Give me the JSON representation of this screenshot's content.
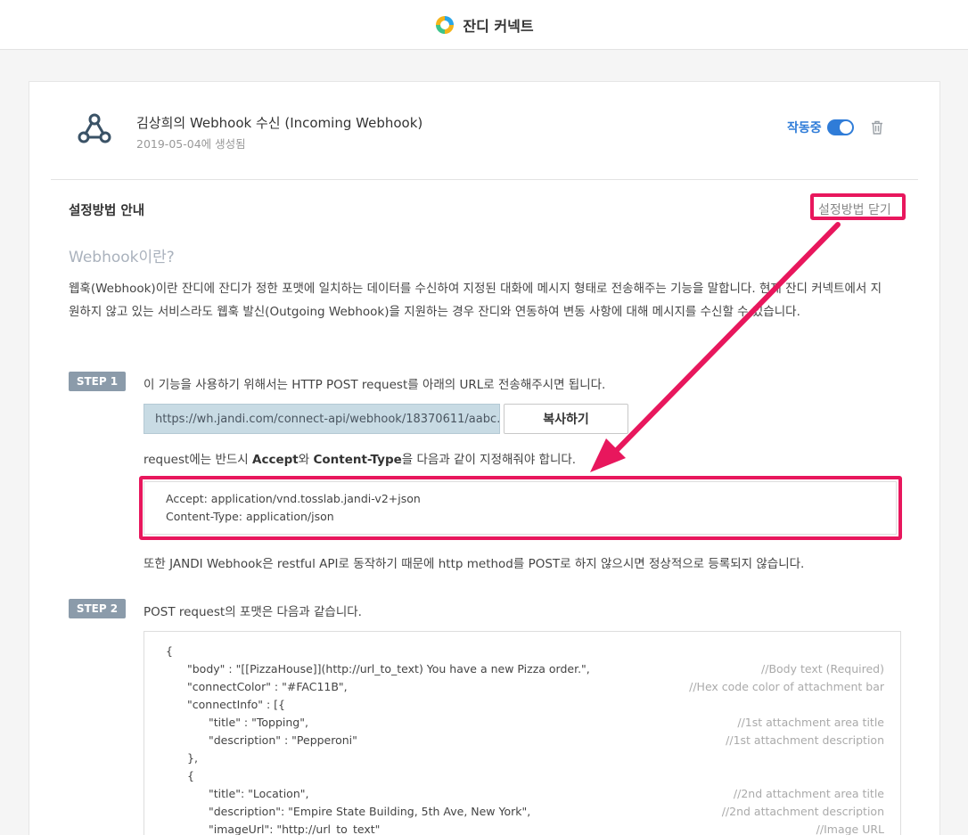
{
  "app": {
    "title": "잔디 커넥트",
    "colors": {
      "accent": "#2f7cd8",
      "highlight": "#e8175d"
    }
  },
  "connector": {
    "title": "김상희의 Webhook 수신 (Incoming Webhook)",
    "created": "2019-05-04에 생성됨",
    "status_label": "작동중",
    "toggle_on": true,
    "icon": "webhook-icon"
  },
  "guide": {
    "title": "설정방법 안내",
    "close_label": "설정방법 닫기",
    "heading": "Webhook이란?",
    "intro": "웹훅(Webhook)이란 잔디에 잔디가 정한 포맷에 일치하는 데이터를 수신하여 지정된 대화에 메시지 형태로 전송해주는 기능을 말합니다. 현재 잔디 커넥트에서 지원하지 않고 있는 서비스라도 웹훅 발신(Outgoing Webhook)을 지원하는 경우 잔디와 연동하여 변동 사항에 대해 메시지를 수신할 수 있습니다."
  },
  "step1": {
    "badge": "STEP 1",
    "text": "이 기능을 사용하기 위해서는 HTTP POST request를 아래의 URL로 전송해주시면 됩니다.",
    "url": "https://wh.jandi.com/connect-api/webhook/18370611/aabc…",
    "copy_label": "복사하기",
    "req_prefix": "request에는 반드시 ",
    "req_accept": "Accept",
    "req_and": "와 ",
    "req_ctype": "Content-Type",
    "req_suffix": "을 다음과 같이 지정해줘야 합니다.",
    "header_accept": "Accept: application/vnd.tosslab.jandi-v2+json",
    "header_ctype": "Content-Type: application/json",
    "rest_note": "또한 JANDI Webhook은 restful API로 동작하기 때문에 http method를 POST로 하지 않으시면 정상적으로 등록되지 않습니다."
  },
  "step2": {
    "badge": "STEP 2",
    "text": "POST request의 포맷은 다음과 같습니다.",
    "code": [
      {
        "code": "{",
        "comment": ""
      },
      {
        "code": "\"body\" : \"[[PizzaHouse]](http://url_to_text) You have a new Pizza order.\",",
        "comment": "//Body text (Required)"
      },
      {
        "code": "\"connectColor\" : \"#FAC11B\",",
        "comment": "//Hex code color of attachment bar"
      },
      {
        "code": "\"connectInfo\" : [{",
        "comment": ""
      },
      {
        "code": "\"title\" : \"Topping\",",
        "comment": "//1st attachment area title"
      },
      {
        "code": "\"description\" : \"Pepperoni\"",
        "comment": "//1st attachment description"
      },
      {
        "code": "},",
        "comment": ""
      },
      {
        "code": "{",
        "comment": ""
      },
      {
        "code": "\"title\": \"Location\",",
        "comment": "//2nd attachment area title"
      },
      {
        "code": "\"description\": \"Empire State Building, 5th Ave, New York\",",
        "comment": "//2nd attachment description"
      },
      {
        "code": "\"imageUrl\": \"http://url_to_text\"",
        "comment": "//Image URL"
      }
    ]
  }
}
